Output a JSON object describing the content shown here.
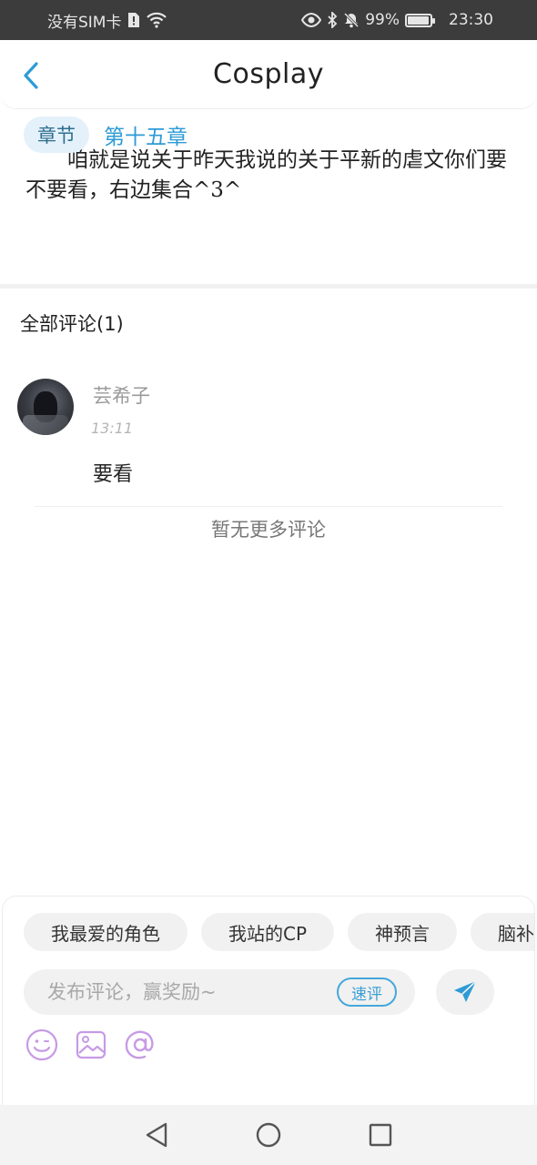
{
  "status_bar": {
    "carrier": "没有SIM卡",
    "battery_percent": "99%",
    "time": "23:30",
    "icons": [
      "sim-alert-icon",
      "wifi-icon",
      "eye-icon",
      "bluetooth-icon",
      "mute-icon",
      "battery-icon"
    ]
  },
  "header": {
    "title": "Cosplay",
    "back_icon": "back-chevron-icon"
  },
  "post": {
    "text": "咱就是说关于昨天我说的关于平新的虐文你们要不要看，右边集合^3^",
    "chapter_tag": "章节",
    "chapter_link": "第十五章"
  },
  "comments": {
    "heading": "全部评论(1)",
    "items": [
      {
        "user": "芸希子",
        "time": "13:11",
        "text": "要看"
      }
    ],
    "no_more": "暂无更多评论"
  },
  "composer": {
    "chips": [
      "我最爱的角色",
      "我站的CP",
      "神预言",
      "脑补"
    ],
    "input_placeholder": "发布评论，赢奖励~",
    "quick_comment": "速评",
    "tools": [
      "emoji-icon",
      "image-icon",
      "mention-icon"
    ]
  },
  "colors": {
    "accent_blue": "#2e9bd6",
    "tool_purple": "#c79be6",
    "status_bar_bg": "#3c3c3c"
  }
}
